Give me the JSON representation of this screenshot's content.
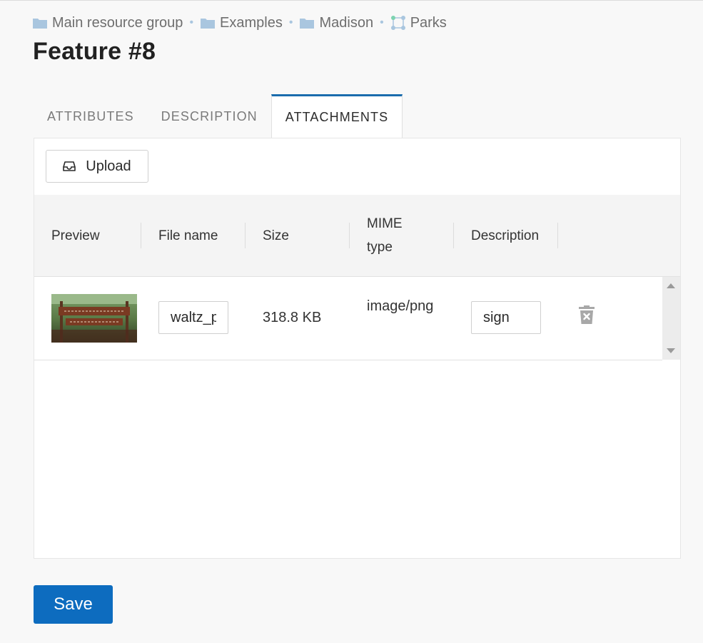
{
  "breadcrumb": {
    "items": [
      {
        "label": "Main resource group",
        "icon": "folder-icon"
      },
      {
        "label": "Examples",
        "icon": "folder-icon"
      },
      {
        "label": "Madison",
        "icon": "folder-icon"
      },
      {
        "label": "Parks",
        "icon": "vector-layer-icon"
      }
    ],
    "separator": "•"
  },
  "page": {
    "title": "Feature #8"
  },
  "tabs": [
    {
      "label": "ATTRIBUTES",
      "active": false
    },
    {
      "label": "DESCRIPTION",
      "active": false
    },
    {
      "label": "ATTACHMENTS",
      "active": true
    }
  ],
  "toolbar": {
    "upload_label": "Upload",
    "upload_icon": "inbox-icon"
  },
  "table": {
    "columns": [
      "Preview",
      "File name",
      "Size",
      "MIME type",
      "Description"
    ],
    "rows": [
      {
        "preview_icon": "park-sign-thumbnail",
        "file_name": "waltz_park_sign.png",
        "size": "318.8 KB",
        "mime_type": "image/png",
        "description": "sign",
        "delete_icon": "trash-icon"
      }
    ]
  },
  "footer": {
    "save_label": "Save"
  },
  "colors": {
    "accent": "#0d6cbf",
    "tab_indicator": "#1a6cad",
    "folder": "#a9c6df"
  }
}
